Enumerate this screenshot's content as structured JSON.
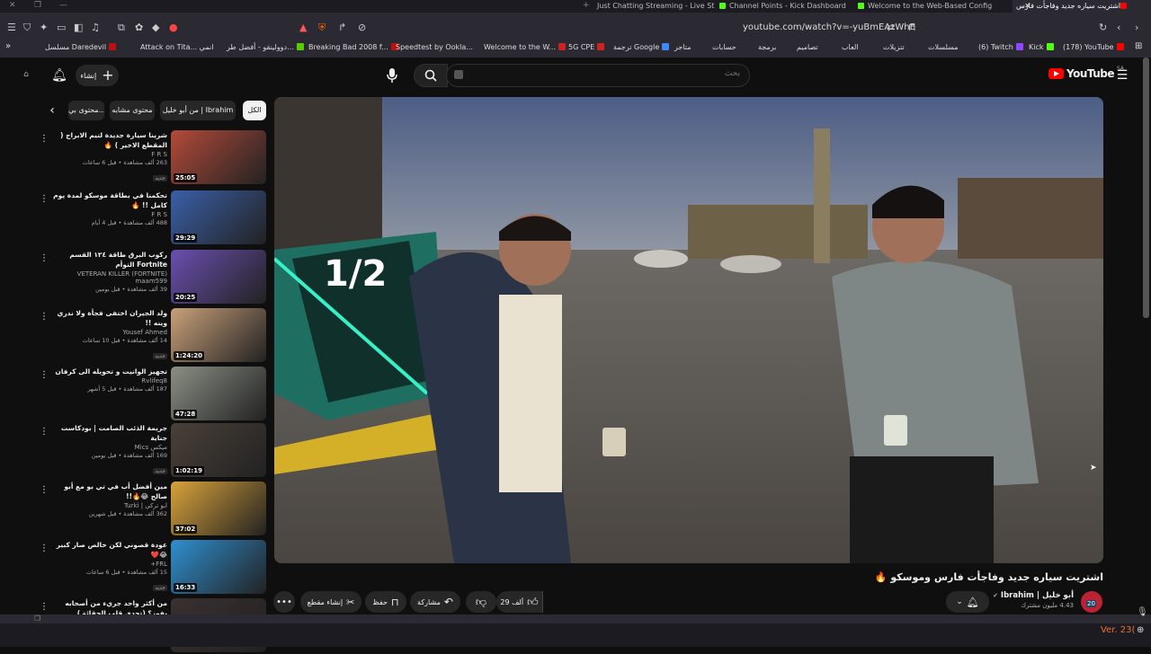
{
  "browser": {
    "tabs": [
      {
        "label": "Just Chatting Streaming - Live Streams",
        "color": "#53fc18"
      },
      {
        "label": "Channel Points - Kick Dashboard",
        "color": "#53fc18"
      },
      {
        "label": "Welcome to the Web-Based Config",
        "color": "#999999"
      },
      {
        "label": "اشتريت سياره جديد وفاجأت فارس",
        "color": "#ff0000"
      }
    ],
    "url": "youtube.com/watch?v=-yuBmEAzWhE",
    "bookmarks": [
      "مسلسل Daredevil",
      "Attack on Tita... انمي",
      "دوولينقو - أفضل طر...",
      "Breaking Bad 2008 f...",
      "Speedtest by Ookla...",
      "Welcome to the W...",
      "5G CPE",
      "ترجمة Google",
      "متاجر",
      "حسابات",
      "برمجة",
      "تصاميم",
      "العاب",
      "تنزيلات",
      "مسلسلات",
      "(6) Twitch",
      "Kick",
      "(178) YouTube"
    ]
  },
  "masthead": {
    "create_label": "إنشاء",
    "search_placeholder": "بحث",
    "logo_text": "YouTube",
    "region": "SA"
  },
  "chips": [
    "الكل",
    "من أبو خليل | Ibrahim",
    "محتوى مشابه",
    "محتوى بي..."
  ],
  "recommendations": [
    {
      "title": "شرينا سيارة جديدة لتيم الابراج ( المقطع الاخير ) 🔥",
      "channel": "F R S",
      "stats": "263 ألف مشاهدة • قبل 6 ساعات",
      "badge": "جديد",
      "duration": "25:05",
      "thumb": "#b34a3a"
    },
    {
      "title": "تحكمنا في بطاقة موسكو لمدة يوم كامل !! 🔥",
      "channel": "F R S",
      "stats": "488 ألف مشاهدة • قبل 4 أيام",
      "badge": "",
      "duration": "29:29",
      "thumb": "#3a5fa8"
    },
    {
      "title": "ركوب البرق طاقة ١٢٤ القسم Fortnite التوأم",
      "channel": "VETERAN KILLER (FORTNITE) maam599",
      "stats": "39 ألف مشاهدة • قبل يومين",
      "badge": "",
      "duration": "20:25",
      "thumb": "#6a4fb0"
    },
    {
      "title": "ولد الجيران اختفى فجأة ولا ندري وينه !!",
      "channel": "Yousef Ahmed",
      "stats": "14 ألف مشاهدة • قبل 10 ساعات",
      "badge": "جديد",
      "duration": "1:24:20",
      "thumb": "#c9a07a"
    },
    {
      "title": "تجهيز الوانيت و تحويله الى كرفان",
      "channel": "Rvlifeq8",
      "stats": "187 ألف مشاهدة • قبل 5 أشهر",
      "badge": "",
      "duration": "47:28",
      "thumb": "#8a8f84"
    },
    {
      "title": "جريمة الذئب الصامت | بودكاست جناية",
      "channel": "ميكس Mics",
      "stats": "169 ألف مشاهدة • قبل يومين",
      "badge": "جديد",
      "duration": "1:02:19",
      "thumb": "#4a4038"
    },
    {
      "title": "مين أفضل أب في تي بو مع أبو صالح 😂🔥!!",
      "channel": "ابو تركي | Turki",
      "stats": "362 ألف مشاهدة • قبل شهرين",
      "badge": "",
      "duration": "37:02",
      "thumb": "#d9a23a"
    },
    {
      "title": "عودة قصوني لكن خالص صار كبير 😂❤️",
      "channel": "FRL+",
      "stats": "15 ألف مشاهدة • قبل 6 ساعات",
      "badge": "جديد",
      "duration": "16:33",
      "thumb": "#2f8fd0"
    },
    {
      "title": "من أكثر واحد جريء من أصحابه يفوز؟ (تحدي قلب الحقائق)",
      "channel": "",
      "stats": "",
      "badge": "",
      "duration": "",
      "thumb": "#3a3030"
    }
  ],
  "video": {
    "title": "اشتريت سياره جديد وفاجأت فارس وموسكو 🔥",
    "channel": "أبو خليل | Ibrahim",
    "subscribers": "4.43 مليون مشترك",
    "avatar_badge": "20",
    "likes": "29 ألف",
    "share_label": "مشاركة",
    "save_label": "حفظ",
    "clip_label": "إنشاء مقطع"
  },
  "status": {
    "version": "Ver. 23("
  }
}
